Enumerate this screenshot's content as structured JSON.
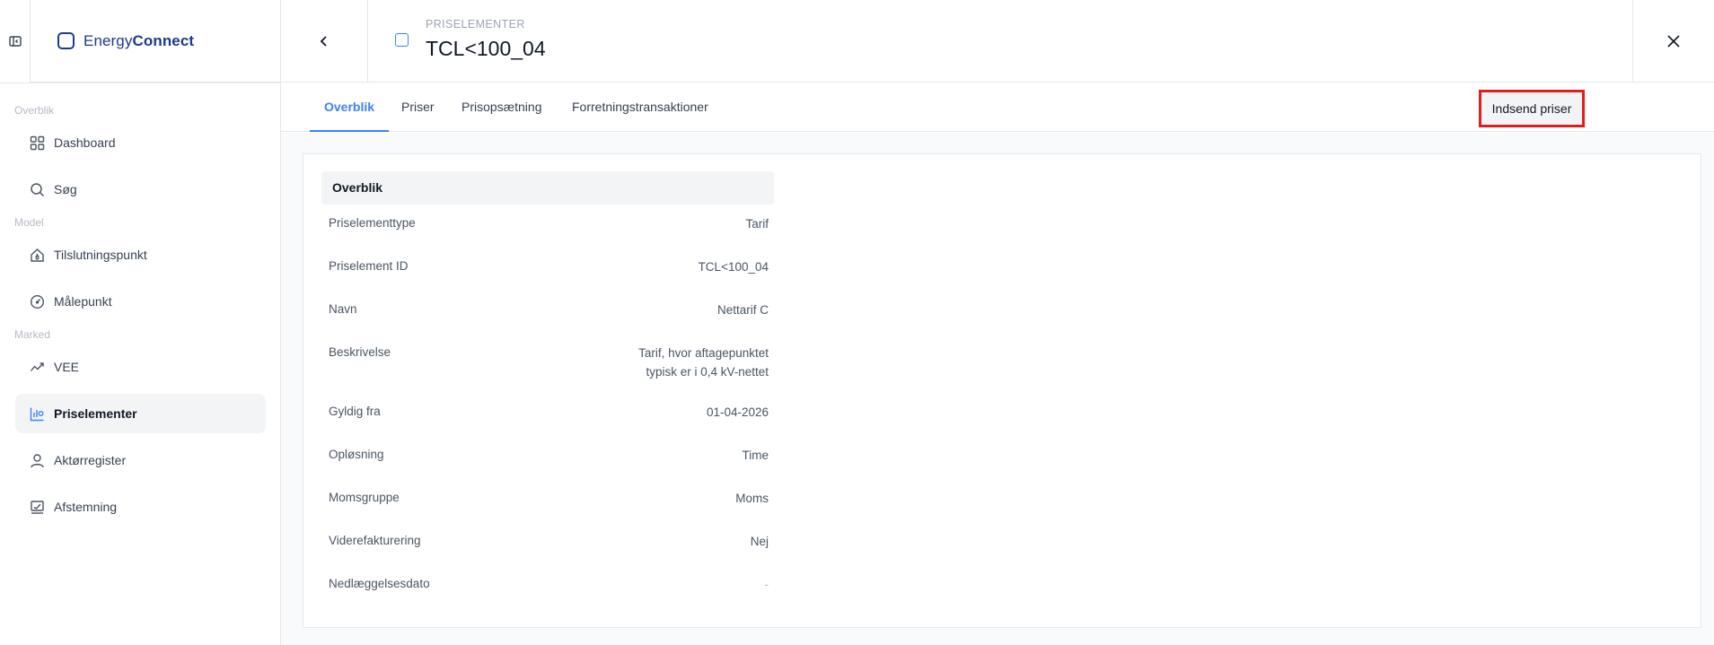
{
  "app": {
    "brand_prefix": "Energy",
    "brand_suffix": "Connect"
  },
  "header": {
    "label": "PRISELEMENTER",
    "title": "TCL<100_04"
  },
  "sidebar": {
    "sections": {
      "overview": "Overblik",
      "model": "Model",
      "market": "Marked"
    },
    "items": {
      "dashboard": "Dashboard",
      "search": "Søg",
      "connection": "Tilslutningspunkt",
      "meter": "Målepunkt",
      "vee": "VEE",
      "price": "Priselementer",
      "actors": "Aktørregister",
      "settlement": "Afstemning"
    }
  },
  "tabs": {
    "overview": "Overblik",
    "prices": "Priser",
    "price_setup": "Prisopsætning",
    "transactions": "Forretningstransaktioner",
    "submit": "Indsend priser"
  },
  "card": {
    "title": "Overblik",
    "rows": [
      {
        "label": "Priselementtype",
        "value": "Tarif"
      },
      {
        "label": "Priselement ID",
        "value": "TCL<100_04"
      },
      {
        "label": "Navn",
        "value": "Nettarif C"
      },
      {
        "label": "Beskrivelse",
        "value_line1": "Tarif, hvor aftagepunktet",
        "value_line2": "typisk er i 0,4 kV-nettet"
      },
      {
        "label": "Gyldig fra",
        "value": "01-04-2026"
      },
      {
        "label": "Opløsning",
        "value": "Time"
      },
      {
        "label": "Momsgruppe",
        "value": "Moms"
      },
      {
        "label": "Viderefakturering",
        "value": "Nej"
      },
      {
        "label": "Nedlæggelsesdato",
        "value": "-"
      }
    ]
  }
}
